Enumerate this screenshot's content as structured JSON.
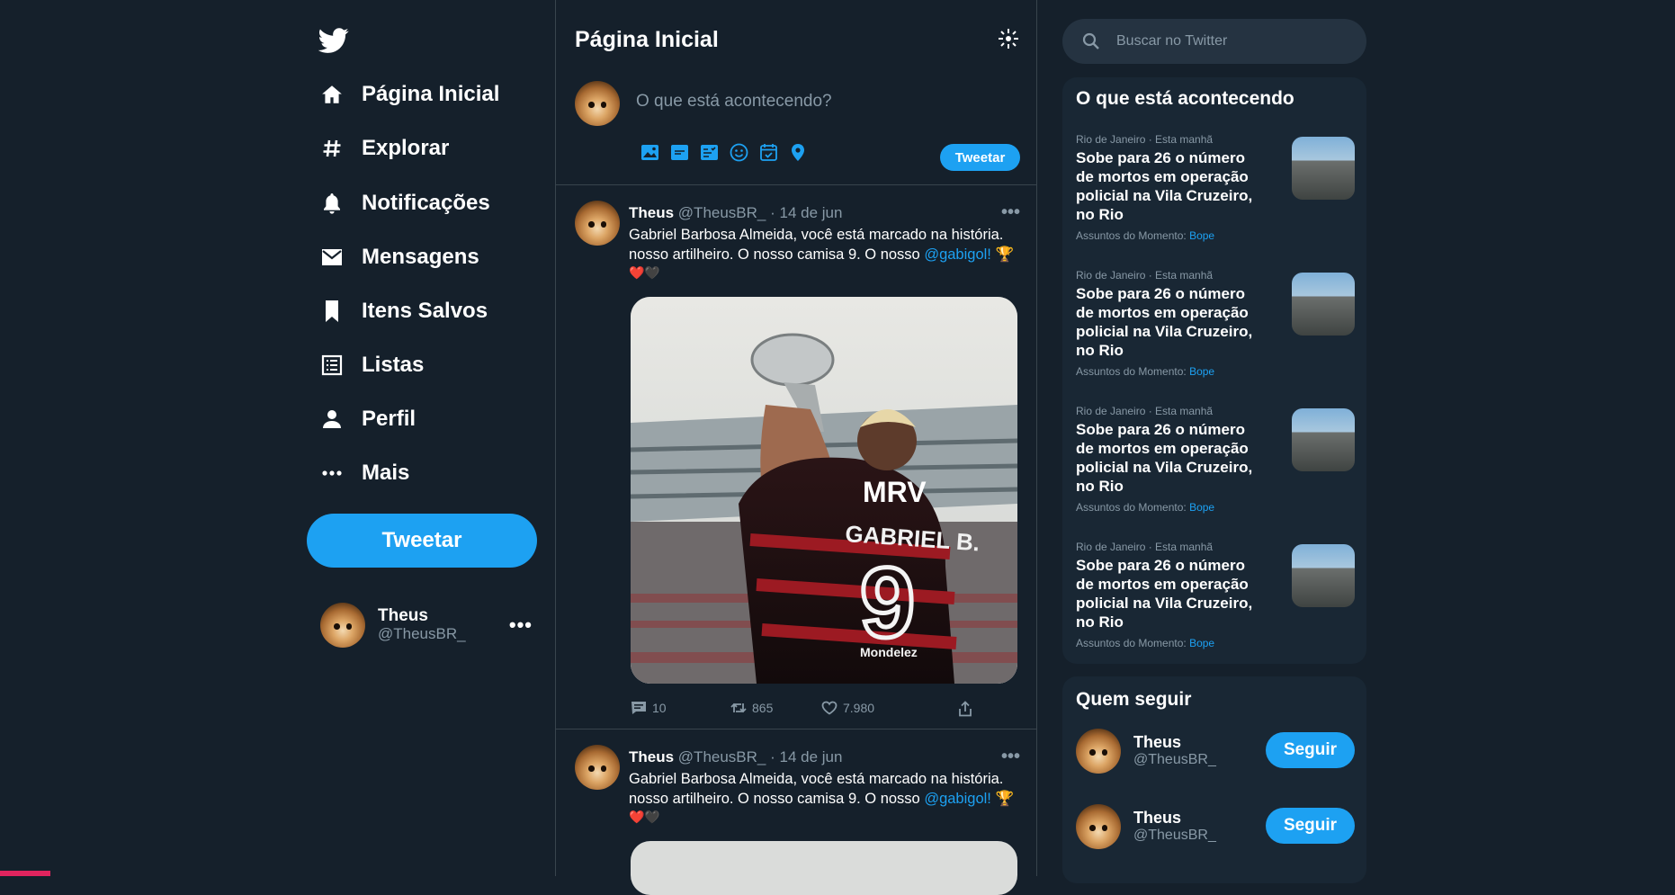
{
  "nav": {
    "items": [
      {
        "label": "Página Inicial",
        "icon": "home-icon"
      },
      {
        "label": "Explorar",
        "icon": "hashtag-icon"
      },
      {
        "label": "Notificações",
        "icon": "bell-icon"
      },
      {
        "label": "Mensagens",
        "icon": "mail-icon"
      },
      {
        "label": "Itens Salvos",
        "icon": "bookmark-icon"
      },
      {
        "label": "Listas",
        "icon": "list-icon"
      },
      {
        "label": "Perfil",
        "icon": "person-icon"
      },
      {
        "label": "Mais",
        "icon": "more-icon"
      }
    ],
    "tweet_button": "Tweetar"
  },
  "account": {
    "name": "Theus",
    "handle": "@TheusBR_",
    "more": "•••"
  },
  "main": {
    "title": "Página Inicial",
    "composer": {
      "placeholder": "O que está acontecendo?",
      "tweet_button": "Tweetar"
    }
  },
  "tweets": [
    {
      "name": "Theus",
      "handle": "@TheusBR_",
      "date": "· 14 de jun",
      "more": "•••",
      "text_before": "Gabriel Barbosa Almeida, você está marcado na história. nosso artilheiro. O nosso camisa 9. O nosso ",
      "mention": "@gabigol!",
      "emoji": "🏆",
      "hearts": "❤️🖤",
      "media": {
        "brand": "MRV",
        "player_name": "GABRIEL B.",
        "number": "9",
        "sponsor": "Mondelez"
      },
      "replies": "10",
      "retweets": "865",
      "likes": "7.980"
    },
    {
      "name": "Theus",
      "handle": "@TheusBR_",
      "date": "· 14 de jun",
      "more": "•••",
      "text_before": "Gabriel Barbosa Almeida, você está marcado na história. nosso artilheiro. O nosso camisa 9. O nosso ",
      "mention": "@gabigol!",
      "emoji": "🏆",
      "hearts": "❤️🖤"
    }
  ],
  "search": {
    "placeholder": "Buscar no Twitter"
  },
  "trends": {
    "title": "O que está acontecendo",
    "items": [
      {
        "context": "Rio de Janeiro · Esta manhã",
        "headline": "Sobe para 26 o número de mortos em operação policial na Vila Cruzeiro, no Rio",
        "topic_prefix": "Assuntos do Momento: ",
        "topic": "Bope"
      },
      {
        "context": "Rio de Janeiro · Esta manhã",
        "headline": "Sobe para 26 o número de mortos em operação policial na Vila Cruzeiro, no Rio",
        "topic_prefix": "Assuntos do Momento: ",
        "topic": "Bope"
      },
      {
        "context": "Rio de Janeiro · Esta manhã",
        "headline": "Sobe para 26 o número de mortos em operação policial na Vila Cruzeiro, no Rio",
        "topic_prefix": "Assuntos do Momento: ",
        "topic": "Bope"
      },
      {
        "context": "Rio de Janeiro · Esta manhã",
        "headline": "Sobe para 26 o número de mortos em operação policial na Vila Cruzeiro, no Rio",
        "topic_prefix": "Assuntos do Momento: ",
        "topic": "Bope"
      }
    ]
  },
  "who_to_follow": {
    "title": "Quem seguir",
    "items": [
      {
        "name": "Theus",
        "handle": "@TheusBR_",
        "button": "Seguir"
      },
      {
        "name": "Theus",
        "handle": "@TheusBR_",
        "button": "Seguir"
      }
    ]
  },
  "colors": {
    "background": "#15202b",
    "panel": "#192734",
    "accent": "#1da1f2",
    "muted": "#8899a6",
    "border": "#38444d"
  }
}
